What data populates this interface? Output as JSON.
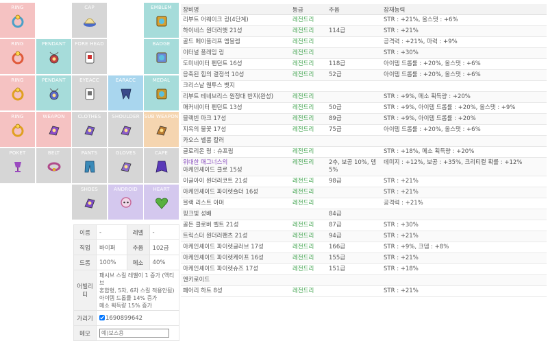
{
  "slots": [
    {
      "key": "ring1",
      "label": "RING",
      "icon": "ring-icon",
      "color": "#4aa0c8"
    },
    {
      "key": "cap",
      "label": "CAP",
      "icon": "cap-icon",
      "color": "#b8a050"
    },
    {
      "key": "emblem",
      "label": "EMBLEM",
      "icon": "emblem-icon",
      "color": "#d8a030"
    },
    {
      "key": "ring2",
      "label": "RING",
      "icon": "ring-icon",
      "color": "#e05a3a"
    },
    {
      "key": "pendant1",
      "label": "PENDANT",
      "icon": "pendant-icon",
      "color": "#c04040"
    },
    {
      "key": "forehead",
      "label": "FORE HEAD",
      "icon": "forehead-icon",
      "color": "#cc3030"
    },
    {
      "key": "badge",
      "label": "BADGE",
      "icon": "badge-icon",
      "color": "#6a8ad8"
    },
    {
      "key": "ring3",
      "label": "RING",
      "icon": "ring-icon",
      "color": "#e0a020"
    },
    {
      "key": "pendant2",
      "label": "PENDANT",
      "icon": "pendant-icon",
      "color": "#5a6ac8"
    },
    {
      "key": "eyeacc",
      "label": "EYEACC",
      "icon": "eye-accessory-icon",
      "color": "#707070"
    },
    {
      "key": "earacc",
      "label": "EARACC",
      "icon": "ear-accessory-icon",
      "color": "#3a4a8a"
    },
    {
      "key": "medal",
      "label": "MEDAL",
      "icon": "medal-icon",
      "color": "#c89a30"
    },
    {
      "key": "ring4",
      "label": "RING",
      "icon": "ring-icon",
      "color": "#e0a020"
    },
    {
      "key": "weapon",
      "label": "WEAPON",
      "icon": "weapon-icon",
      "color": "#8a4ac8"
    },
    {
      "key": "clothes",
      "label": "CLOTHES",
      "icon": "clothes-icon",
      "color": "#7a5ac8"
    },
    {
      "key": "shoulder",
      "label": "SHOULDER",
      "icon": "shoulder-icon",
      "color": "#8a5ac8"
    },
    {
      "key": "subweapon",
      "label": "SUB WEAPON",
      "icon": "sub-weapon-icon",
      "color": "#b87a30"
    },
    {
      "key": "poket",
      "label": "POKET",
      "icon": "pocket-icon",
      "color": "#9a4ac0"
    },
    {
      "key": "belt",
      "label": "BELT",
      "icon": "belt-icon",
      "color": "#b04a8a"
    },
    {
      "key": "pants",
      "label": "PANTS",
      "icon": "pants-icon",
      "color": "#3a8ab8"
    },
    {
      "key": "gloves",
      "label": "GLOVES",
      "icon": "gloves-icon",
      "color": "#8a6ac8"
    },
    {
      "key": "cape",
      "label": "CAPE",
      "icon": "cape-icon",
      "color": "#5a3ab8"
    },
    {
      "key": "shoes",
      "label": "SHOES",
      "icon": "shoes-icon",
      "color": "#7a4ac8"
    },
    {
      "key": "android",
      "label": "ANDROID",
      "icon": "android-icon",
      "color": "#c86a9a"
    },
    {
      "key": "heart",
      "label": "HEART",
      "icon": "heart-icon",
      "color": "#58b040"
    }
  ],
  "info": {
    "name_label": "이름",
    "name_value": "-",
    "level_label": "레벨",
    "level_value": "-",
    "job_label": "직업",
    "job_value": "바이퍼",
    "chuok_label": "추옵",
    "chuok_value": "102급",
    "drop_label": "드롭",
    "drop_value": "100%",
    "meso_label": "메소",
    "meso_value": "40%",
    "ability_label": "어빌리티",
    "ability_line1": "패시브 스킬 레벨이 1 증가 (액티브",
    "ability_line2": "혼합형, 5차, 6차 스킬 적용안됨)",
    "ability_line3": "아이템 드롭률 14% 증가",
    "ability_line4": "메소 획득량 15% 증가",
    "hide_label": "가리기",
    "hide_value": "1690899642",
    "memo_label": "메모",
    "memo_placeholder": "예)보스용"
  },
  "table": {
    "headers": [
      "장비명",
      "등급",
      "추옵",
      "잠재능력"
    ],
    "rows": [
      {
        "name": "리부트 어웨이크 링(4단계)",
        "grade": "레전드리",
        "chuok": "",
        "potential": "STR : +21%, 올스탯 : +6%"
      },
      {
        "name": "하이네스 원더러햇 21성",
        "grade": "레전드리",
        "chuok": "114급",
        "potential": "STR : +21%"
      },
      {
        "name": "골드 메이플리프 엠블렘",
        "grade": "레전드리",
        "chuok": "",
        "potential": "공격력 : +21%, 마력 : +9%"
      },
      {
        "name": "이터널 플레임 링",
        "grade": "레전드리",
        "chuok": "",
        "potential": "STR : +30%"
      },
      {
        "name": "도미네이터 펜던트 16성",
        "grade": "레전드리",
        "chuok": "118급",
        "potential": "아이템 드롭률 : +20%, 올스탯 : +6%"
      },
      {
        "name": "응축된 힘의 결정석 10성",
        "grade": "레전드리",
        "chuok": "52급",
        "potential": "아이템 드롭률 : +20%, 올스탯 : +6%"
      },
      {
        "name": "크리스날 웬투스 뱃지",
        "grade": "",
        "chuok": "",
        "potential": ""
      },
      {
        "name": "리부트 테네브리스 원정대 반지(완성)",
        "grade": "레전드리",
        "chuok": "",
        "potential": "STR : +9%, 메소 획득량 : +20%"
      },
      {
        "name": "매커네이터 펜던트 13성",
        "grade": "레전드리",
        "chuok": "50급",
        "potential": "STR : +9%, 아이템 드롭률 : +20%, 올스탯 : +9%"
      },
      {
        "name": "블랙빈 마크 17성",
        "grade": "레전드리",
        "chuok": "89급",
        "potential": "STR : +9%, 아이템 드롭률 : +20%"
      },
      {
        "name": "지옥의 불꽃 17성",
        "grade": "레전드리",
        "chuok": "75급",
        "potential": "아이템 드롭률 : +20%, 올스탯 : +6%"
      },
      {
        "name": "카오스 벨룸 칼러",
        "grade": "",
        "chuok": "",
        "potential": ""
      },
      {
        "name": "글로리온 링 : 슈프림",
        "grade": "레전드리",
        "chuok": "",
        "potential": "STR : +18%, 메소 획득량 : +20%"
      },
      {
        "name": "위대한 매그너스의",
        "name2": "아케인셰이드 클로 15성",
        "grade": "레전드리",
        "chuok": "2추, 보공 10%, 뎀 5%",
        "potential": "데미지 : +12%, 보공 : +35%, 크리티컬 확률 : +12%",
        "tall": true
      },
      {
        "name": "이글아이 원더러코트 21성",
        "grade": "레전드리",
        "chuok": "98급",
        "potential": "STR : +21%"
      },
      {
        "name": "아케인셰이드 파이렛숄더 16성",
        "grade": "레전드리",
        "chuok": "",
        "potential": "STR : +21%"
      },
      {
        "name": "블랙 리스트 아머",
        "grade": "레전드리",
        "chuok": "",
        "potential": "공격력 : +21%"
      },
      {
        "name": "핑크빛 성배",
        "grade": "",
        "chuok": "84급",
        "potential": ""
      },
      {
        "name": "골든 클로버 벨트 21성",
        "grade": "레전드리",
        "chuok": "87급",
        "potential": "STR : +30%"
      },
      {
        "name": "트릭스터 원더러팬츠 21성",
        "grade": "레전드리",
        "chuok": "94급",
        "potential": "STR : +21%"
      },
      {
        "name": "아케인셰이드 파이렛글러브 17성",
        "grade": "레전드리",
        "chuok": "166급",
        "potential": "STR : +9%, 크뎀 : +8%"
      },
      {
        "name": "아케인셰이드 파이렛케이프 16성",
        "grade": "레전드리",
        "chuok": "155급",
        "potential": "STR : +21%"
      },
      {
        "name": "아케인셰이드 파이렛슈즈 17성",
        "grade": "레전드리",
        "chuok": "151급",
        "potential": "STR : +18%"
      },
      {
        "name": "엔키로이드",
        "grade": "",
        "chuok": "",
        "potential": ""
      },
      {
        "name": "페어리 하트 8성",
        "grade": "레전드리",
        "chuok": "",
        "potential": "STR : +21%"
      }
    ]
  }
}
